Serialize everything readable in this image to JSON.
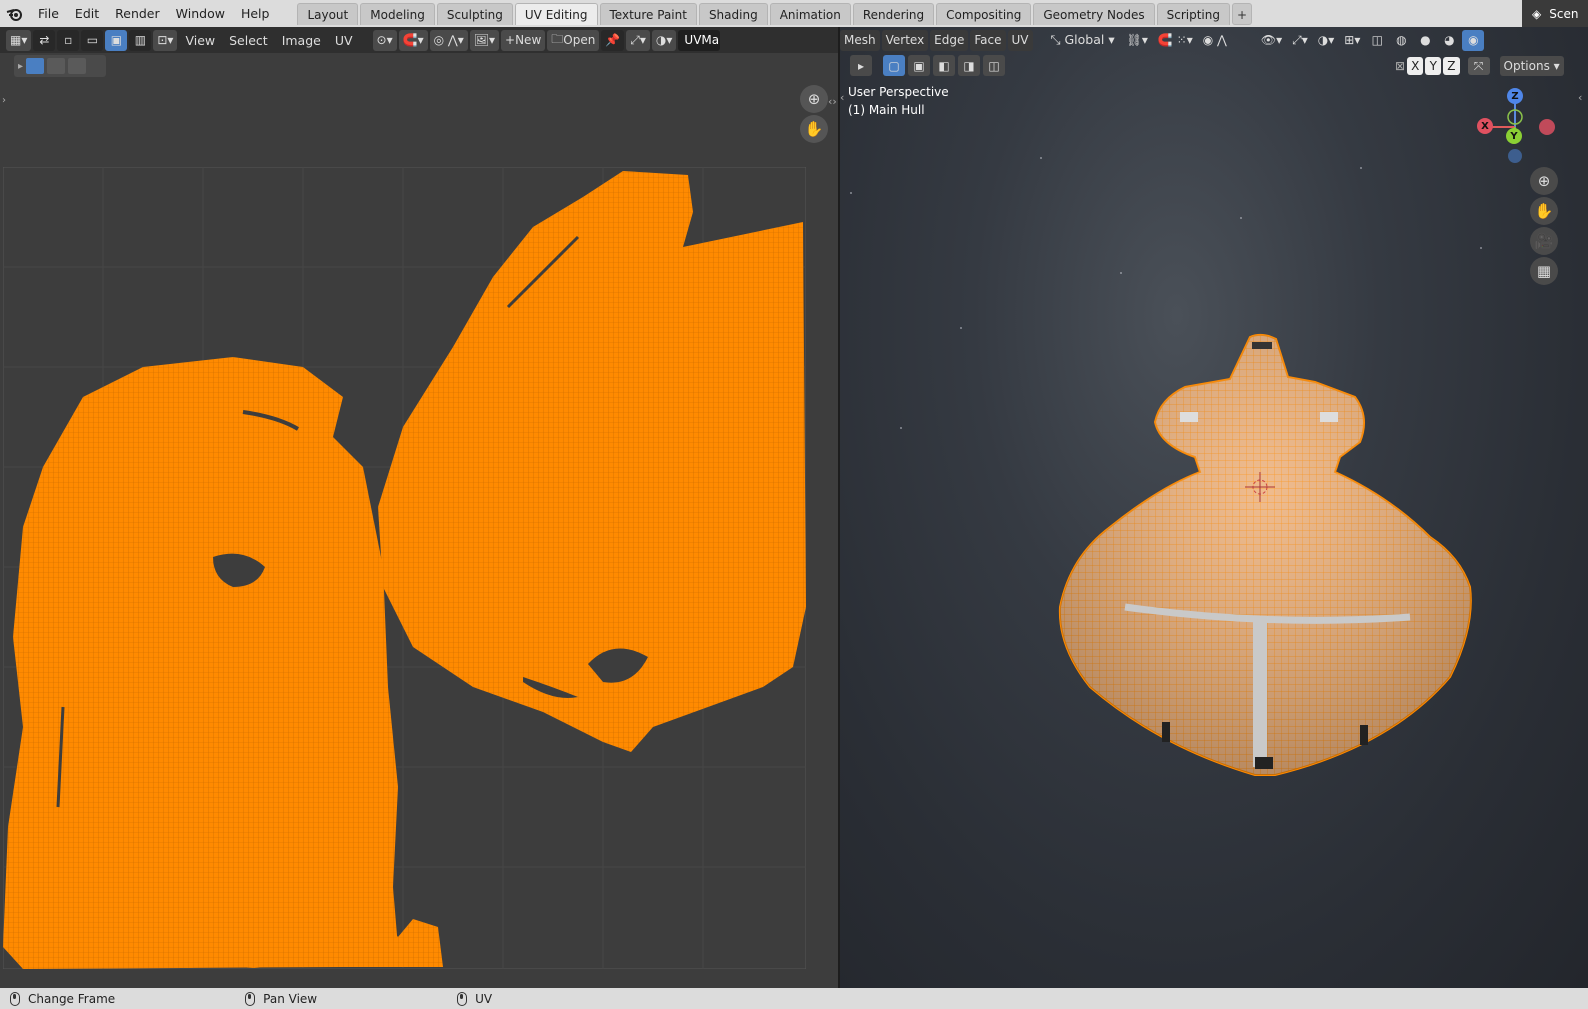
{
  "menu": [
    "File",
    "Edit",
    "Render",
    "Window",
    "Help"
  ],
  "workspaces": [
    "Layout",
    "Modeling",
    "Sculpting",
    "UV Editing",
    "Texture Paint",
    "Shading",
    "Animation",
    "Rendering",
    "Compositing",
    "Geometry Nodes",
    "Scripting"
  ],
  "active_workspace": "UV Editing",
  "scene_label": "Scen",
  "uv_editor": {
    "menus": [
      "View",
      "Select",
      "Image",
      "UV"
    ],
    "new_label": "New",
    "open_label": "Open",
    "uvmap_label": "UVMa"
  },
  "viewport": {
    "mode_menus": [
      "Mesh",
      "Vertex",
      "Edge",
      "Face",
      "UV"
    ],
    "orientation": "Global",
    "options_label": "Options",
    "axis_buttons": [
      "X",
      "Y",
      "Z"
    ],
    "perspective_label": "User Perspective",
    "object_label": "(1) Main Hull",
    "gizmo_axes": {
      "x": "X",
      "y": "Y",
      "z": "Z"
    }
  },
  "status": [
    {
      "label": "Change Frame"
    },
    {
      "label": "Pan View"
    },
    {
      "label": "UV"
    }
  ],
  "colors": {
    "uv_orange": "#ff8a00",
    "hull_orange": "#e9a66a",
    "blender_blue": "#4a7fc2"
  }
}
